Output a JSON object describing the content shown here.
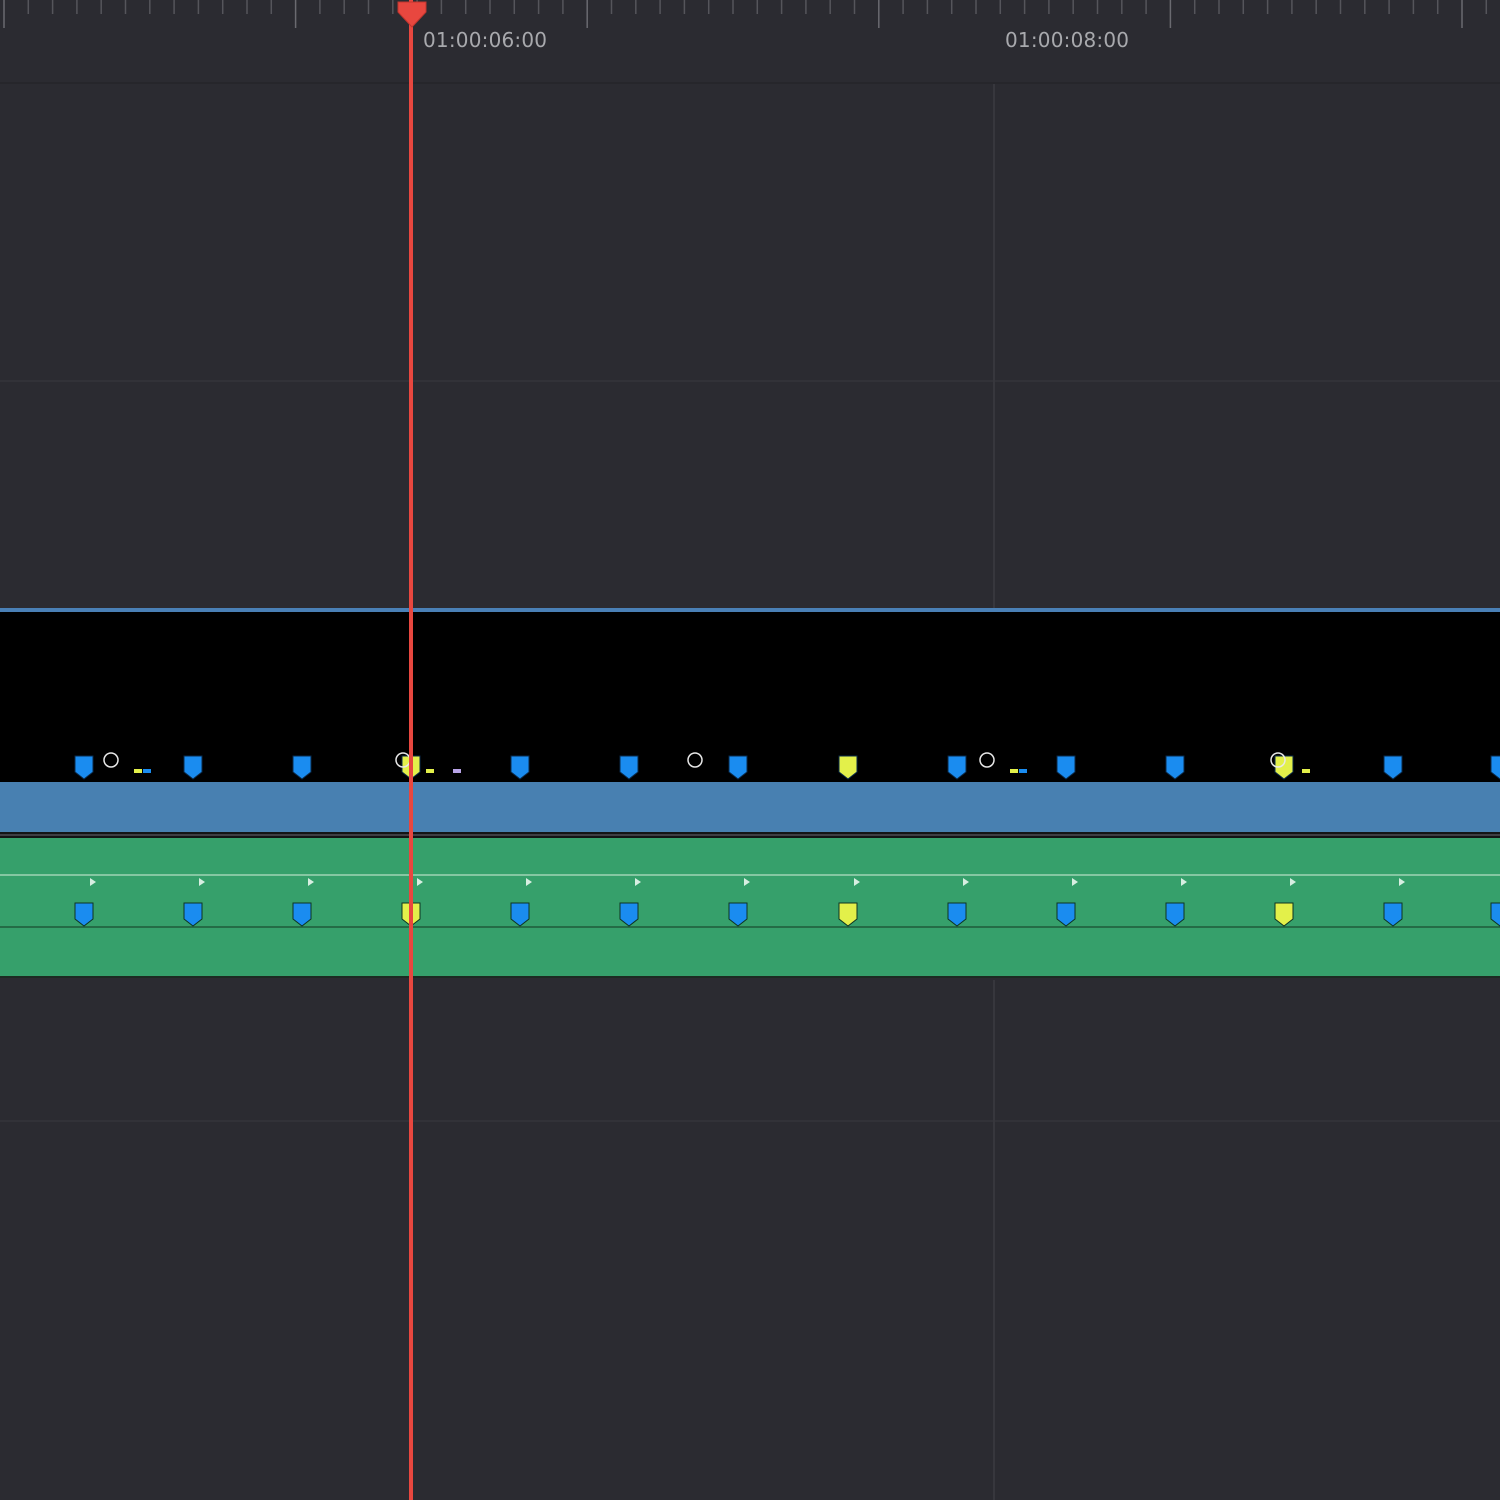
{
  "ruler": {
    "timecodes": [
      "01:00:06:00",
      "01:00:08:00"
    ]
  },
  "colors": {
    "background": "#2b2b31",
    "playhead": "#e8473f",
    "video_clip_bar": "#4880b1",
    "audio_clip": "#36a06b",
    "marker_blue": "#1a8cf0",
    "marker_yellow": "#e3f04a"
  },
  "markers": {
    "video_track": [
      "blue",
      "blue",
      "blue",
      "yellow",
      "blue",
      "blue",
      "blue",
      "yellow",
      "blue",
      "blue",
      "blue",
      "yellow",
      "blue",
      "blue"
    ],
    "audio_track": [
      "blue",
      "blue",
      "blue",
      "yellow",
      "blue",
      "blue",
      "blue",
      "yellow",
      "blue",
      "blue",
      "blue",
      "yellow",
      "blue",
      "blue"
    ]
  },
  "icons": {
    "keyframe": "keyframe-icon",
    "playhead": "playhead-icon"
  }
}
